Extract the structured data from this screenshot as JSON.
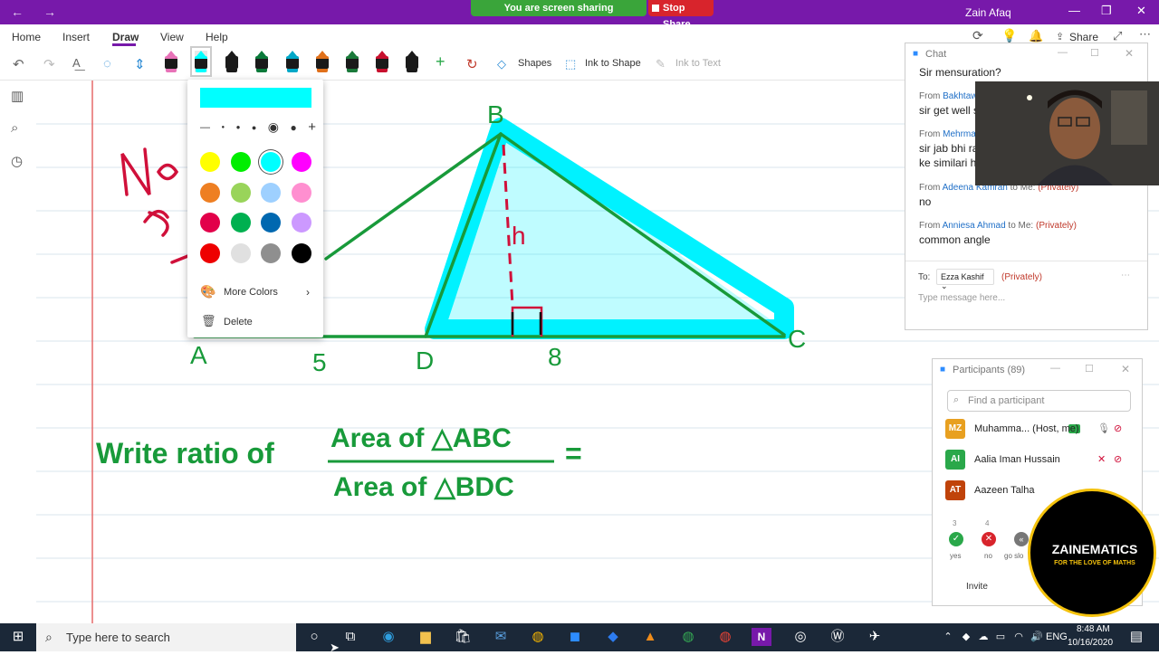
{
  "titlebar": {
    "sharing_text": "You are screen sharing",
    "stop_share_label": "Stop Share",
    "user_name": "Zain Afaq"
  },
  "menu": {
    "items": [
      "Home",
      "Insert",
      "Draw",
      "View",
      "Help"
    ],
    "share_label": "Share"
  },
  "ribbon": {
    "shapes_label": "Shapes",
    "ink_to_shape_label": "Ink to Shape",
    "ink_to_text_label": "Ink to Text",
    "pen_colors": [
      "#e872b8",
      "#00ffff",
      "#1a1a1a",
      "#0a7a3a",
      "#00a8c8",
      "#e0701a",
      "#1a7a3a",
      "#c8102e",
      "#1a1a1a"
    ]
  },
  "pen_popup": {
    "current_color": "#00ffff",
    "sizes": [
      "—",
      "•",
      "•",
      "•",
      "◉",
      "●",
      "+"
    ],
    "colors": [
      "#ffff00",
      "#00ee00",
      "#00ffff",
      "#ff00ff",
      "#ee7f22",
      "#99d45a",
      "#9ed0ff",
      "#ff8fd0",
      "#e2004a",
      "#00b050",
      "#0068b0",
      "#cc99ff",
      "#ee0000",
      "#e0e0e0",
      "#8f8f8f",
      "#000000"
    ],
    "more_colors_label": "More Colors",
    "delete_label": "Delete"
  },
  "drawing": {
    "vertex_b": "B",
    "vertex_c": "C",
    "vertex_a": "A",
    "vertex_d": "D",
    "height_label": "h",
    "len_ad": "5",
    "len_dc": "8",
    "ratio_prefix": "Write ratio of",
    "numerator": "Area of △ABC",
    "denominator": "Area of △BDC",
    "equals": "=",
    "red_scribble": "No\nSi"
  },
  "chat": {
    "title": "Chat",
    "messages": [
      {
        "from": "",
        "text": "Sir mensuration?"
      },
      {
        "from": "Bakhtaw",
        "text": "sir get well s"
      },
      {
        "from": "Mehrma",
        "text": "sir jab bhi ra"
      },
      {
        "from": "",
        "text": "ke similari h"
      },
      {
        "from": "Adeena Kamran",
        "text": "no"
      },
      {
        "from": "Anniesa Ahmad",
        "text": "common angle"
      }
    ],
    "from_prefix": "From",
    "to_me": "to Me:",
    "privately": "(Privately)",
    "to_label": "To:",
    "to_recipient": "Ezza Kashif",
    "placeholder": "Type message here..."
  },
  "participants": {
    "title": "Participants (89)",
    "search_placeholder": "Find a participant",
    "rows": [
      {
        "initials": "MZ",
        "color": "#e8a020",
        "name": "Muhamma... (Host, me)"
      },
      {
        "initials": "AI",
        "color": "#2aa84a",
        "name": "Aalia Iman Hussain"
      },
      {
        "initials": "AT",
        "color": "#c0430a",
        "name": "Aazeen Talha"
      }
    ],
    "reactions": [
      {
        "count": "3",
        "label": "yes"
      },
      {
        "count": "4",
        "label": "no"
      },
      {
        "count": "",
        "label": "go slo"
      }
    ],
    "invite_label": "Invite"
  },
  "logo": {
    "title": "ZAINEMATICS",
    "tagline": "FOR THE LOVE OF MATHS"
  },
  "taskbar": {
    "search_placeholder": "Type here to search",
    "time": "8:48 AM",
    "date": "10/16/2020"
  }
}
